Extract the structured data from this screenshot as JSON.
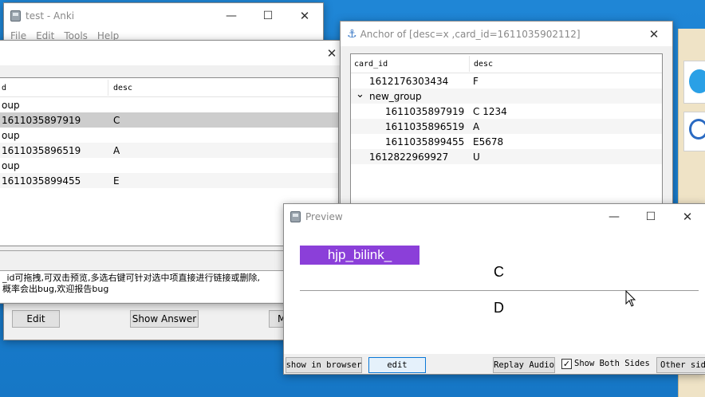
{
  "main_window": {
    "title": "test - Anki",
    "menu": [
      "File",
      "Edit",
      "Tools",
      "Help"
    ],
    "buttons": {
      "edit": "Edit",
      "show_answer": "Show Answer",
      "more_partial": "M"
    }
  },
  "browser_dialog": {
    "columns": {
      "card_id": "d",
      "desc": "desc"
    },
    "rows": [
      {
        "card_id": "oup",
        "desc": ""
      },
      {
        "card_id": "1611035897919",
        "desc": "C"
      },
      {
        "card_id": "oup",
        "desc": ""
      },
      {
        "card_id": "1611035896519",
        "desc": "A"
      },
      {
        "card_id": "oup",
        "desc": ""
      },
      {
        "card_id": "1611035899455",
        "desc": "E"
      }
    ],
    "hint_line1": "_id可拖拽,可双击预览,多选右键可针对选中项直接进行链接或删除,",
    "hint_line2": "概率会出bug,欢迎报告bug"
  },
  "anchor_window": {
    "title": "Anchor of [desc=x ,card_id=1611035902112]",
    "columns": {
      "card_id": "card_id",
      "desc": "desc"
    },
    "rows": [
      {
        "card_id": "1612176303434",
        "desc": "F",
        "indent": 0
      },
      {
        "card_id": "new_group",
        "desc": "",
        "indent": 0,
        "expanded": true
      },
      {
        "card_id": "1611035897919",
        "desc": "C 1234",
        "indent": 1
      },
      {
        "card_id": "1611035896519",
        "desc": "A",
        "indent": 1
      },
      {
        "card_id": "1611035899455",
        "desc": "E5678",
        "indent": 1
      },
      {
        "card_id": "1612822969927",
        "desc": "U",
        "indent": 0
      }
    ]
  },
  "preview_window": {
    "title": "Preview",
    "tag_label": "hjp_bilink_",
    "front": "C",
    "back": "D",
    "buttons": {
      "show_in_browser": "show in browser",
      "edit": "edit",
      "replay_audio": "Replay Audio",
      "show_both_sides": "Show Both Sides",
      "other_side": "Other side"
    },
    "show_both_sides_checked": true,
    "tag_color": "#8b3fd9"
  },
  "icons": {
    "minimize": "—",
    "maximize": "☐",
    "close": "✕",
    "anchor": "⚓",
    "chevron": "⌄",
    "check": "✓"
  }
}
